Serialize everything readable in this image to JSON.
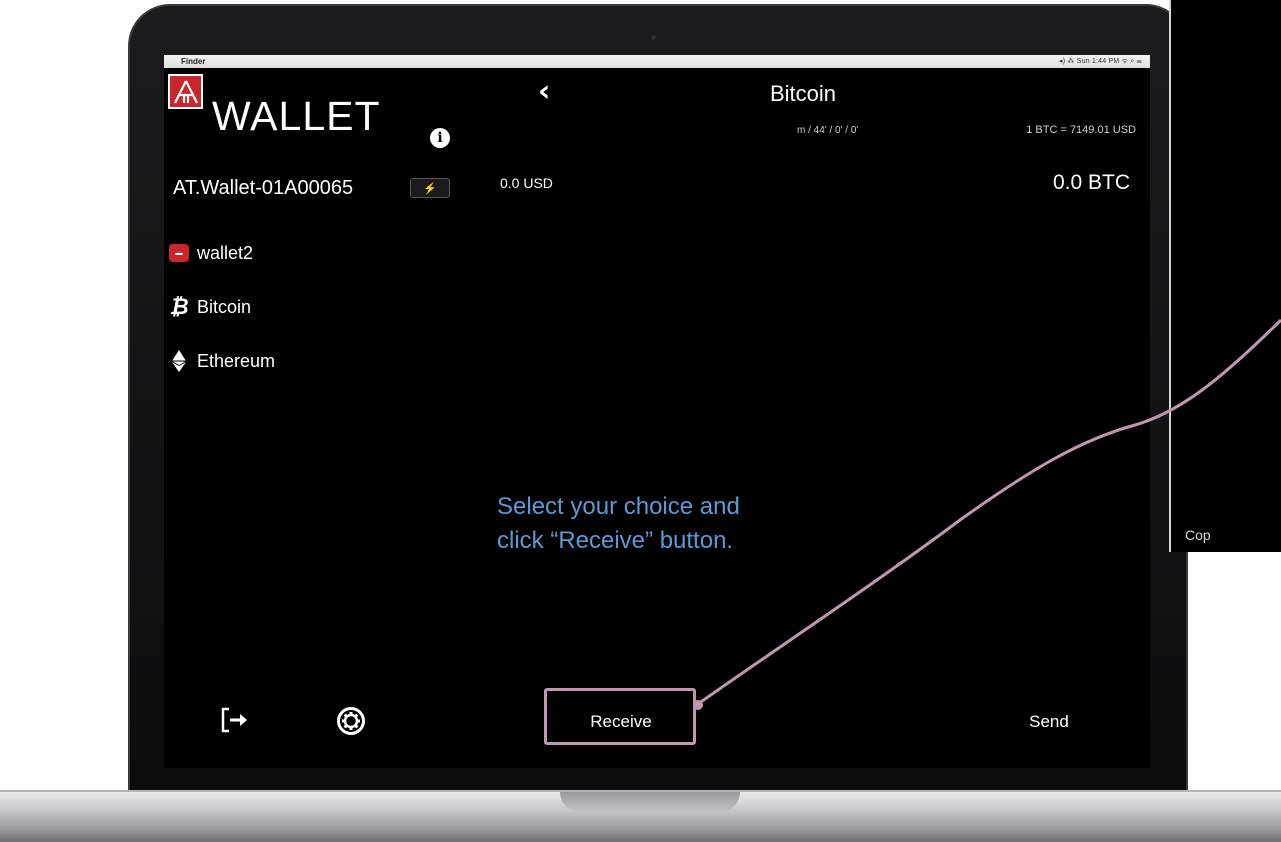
{
  "menubar": {
    "app_name": "Finder",
    "status_text": "◂)  ⁂  Sun 1:44 PM  ᯤ  ⌕  ☰"
  },
  "sidebar": {
    "logo_text": "WALLET",
    "device_name": "AT.Wallet-01A00065",
    "device_badge": "⚡",
    "items": [
      {
        "label": "wallet2",
        "icon": "wallet-icon"
      },
      {
        "label": "Bitcoin",
        "icon": "bitcoin-icon"
      },
      {
        "label": "Ethereum",
        "icon": "ethereum-icon"
      }
    ]
  },
  "main": {
    "title": "Bitcoin",
    "derivation_path": "m / 44' / 0' / 0'",
    "exchange_rate": "1 BTC = 7149.01 USD",
    "usd_balance": "0.0 USD",
    "btc_balance": "0.0 BTC"
  },
  "toolbar": {
    "receive_label": "Receive",
    "send_label": "Send"
  },
  "side_panel": {
    "partial_text": "Cop"
  },
  "annotation": {
    "line1": "Select your choice and",
    "line2": "click “Receive” button.",
    "color": "#5b9bd5",
    "highlight_color": "#c295b0"
  },
  "colors": {
    "brand_red": "#c9272d",
    "screen_background": "#000000"
  }
}
